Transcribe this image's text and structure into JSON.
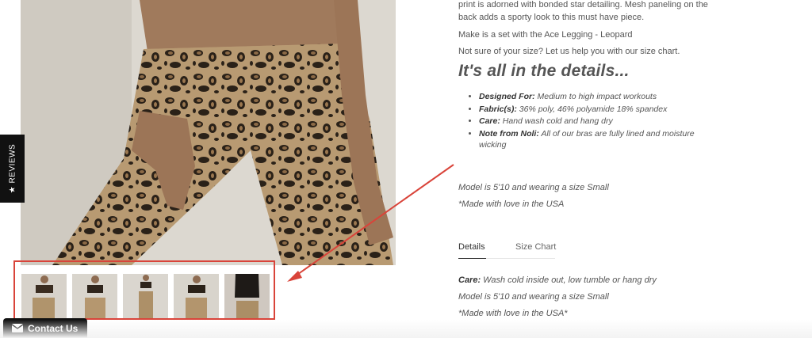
{
  "description": {
    "line1": "print is adorned with bonded star detailing.   Mesh paneling on the",
    "line2": "back adds a sporty look to this must have piece.",
    "set_note": "Make is a set with the Ace Legging - Leopard",
    "size_help": "Not sure of your size? Let us help you with our size chart."
  },
  "details": {
    "heading": "It's all in the details...",
    "items": [
      {
        "label": "Designed For:",
        "value": " Medium to high impact workouts"
      },
      {
        "label": "Fabric(s):",
        "value": " 36% poly, 46% polyamide 18% spandex"
      },
      {
        "label": "Care:",
        "value": " Hand wash cold and hang dry"
      },
      {
        "label": "Note from Noli:",
        "value": " All of our bras are fully lined and moisture wicking"
      }
    ],
    "model_note": "Model is 5'10 and wearing a size Small",
    "made_note": "*Made with love in the USA"
  },
  "tabs": [
    {
      "label": "Details",
      "active": true
    },
    {
      "label": "Size Chart",
      "active": false
    }
  ],
  "tab_content": {
    "care_label": "Care:",
    "care_value": " Wash cold inside out, low tumble or hang dry",
    "model_note": "Model is 5'10 and wearing a size Small",
    "made_note": "*Made with love in the USA*"
  },
  "reviews_tab": {
    "label": "★ REVIEWS"
  },
  "contact": {
    "label": "Contact Us",
    "icon": "envelope-icon"
  },
  "thumbnails": [
    {
      "alt": "thumbnail-1"
    },
    {
      "alt": "thumbnail-2"
    },
    {
      "alt": "thumbnail-3"
    },
    {
      "alt": "thumbnail-4"
    },
    {
      "alt": "thumbnail-5"
    }
  ],
  "annotation": {
    "color": "#d9443a"
  }
}
